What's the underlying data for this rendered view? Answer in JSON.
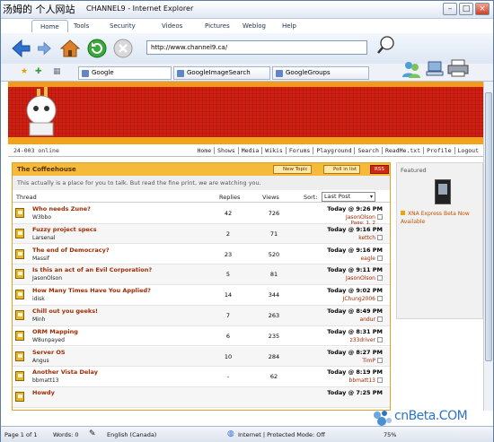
{
  "window": {
    "watermark": "汤姆的 个人网站",
    "title": "CHANNEL9 - Internet Explorer"
  },
  "menu": [
    "Home",
    "Tools",
    "Security",
    "Videos",
    "Pictures",
    "Weblog",
    "Help"
  ],
  "address": "http://www.channel9.ca/",
  "tabs": [
    "Google",
    "GoogleImageSearch",
    "GoogleGroups"
  ],
  "site": {
    "online": "24-003 online",
    "links": [
      "Home",
      "Shows",
      "Media",
      "Wikis",
      "Forums",
      "Playground",
      "Search",
      "ReadMe.txt",
      "Profile",
      "Logout"
    ]
  },
  "forum": {
    "title": "The Coffeehouse",
    "btn_new": "New Topic",
    "btn_poll": "Poll in list",
    "btn_rss": "RSS",
    "description": "This actually is a place for you to talk. But read the fine print, we are watching you.",
    "col_thread": "Thread",
    "col_replies": "Replies",
    "col_views": "Views",
    "sort_label": "Sort:",
    "sort_value": "Last Post",
    "rows": [
      {
        "title": "Who needs Zune?",
        "author": "W3bbo",
        "replies": "42",
        "views": "726",
        "time": "Today @ 9:26 PM",
        "by": "JasonOlson",
        "pages": "Page: 1, 2"
      },
      {
        "title": "Fuzzy project specs",
        "author": "Larsenal",
        "replies": "2",
        "views": "71",
        "time": "Today @ 9:16 PM",
        "by": "kettch",
        "pages": ""
      },
      {
        "title": "The end of Democracy?",
        "author": "Massif",
        "replies": "23",
        "views": "520",
        "time": "Today @ 9:16 PM",
        "by": "eagle",
        "pages": ""
      },
      {
        "title": "Is this an act of an Evil Corporation?",
        "author": "JasonOlson",
        "replies": "5",
        "views": "81",
        "time": "Today @ 9:11 PM",
        "by": "JasonOlson",
        "pages": ""
      },
      {
        "title": "How Many Times Have You Applied?",
        "author": "idisk",
        "replies": "14",
        "views": "344",
        "time": "Today @ 9:02 PM",
        "by": "JChung2006",
        "pages": ""
      },
      {
        "title": "Chill out you geeks!",
        "author": "Minh",
        "replies": "7",
        "views": "263",
        "time": "Today @ 8:49 PM",
        "by": "andur",
        "pages": ""
      },
      {
        "title": "ORM Mapping",
        "author": "W8unpayed",
        "replies": "6",
        "views": "235",
        "time": "Today @ 8:31 PM",
        "by": "z33driver",
        "pages": ""
      },
      {
        "title": "Server OS",
        "author": "Angus",
        "replies": "10",
        "views": "284",
        "time": "Today @ 8:27 PM",
        "by": "TimP",
        "pages": ""
      },
      {
        "title": "Another Vista Delay",
        "author": "bbmatt13",
        "replies": "-",
        "views": "62",
        "time": "Today @ 8:19 PM",
        "by": "bbmatt13",
        "pages": ""
      },
      {
        "title": "Howdy",
        "author": "",
        "replies": "",
        "views": "",
        "time": "Today @ 7:25 PM",
        "by": "",
        "pages": ""
      }
    ]
  },
  "featured": {
    "heading": "Featured",
    "link": "XNA Express Beta Now Available"
  },
  "status": {
    "page": "Page 1 of 1",
    "words": "Words: 0",
    "language": "English (Canada)",
    "zone": "Internet | Protected Mode: Off",
    "zoom": "75%"
  },
  "cnbeta": "cnBeta.COM",
  "colors": {
    "accent": "#d01f12",
    "forum_header": "#f6ba3a",
    "link": "#a02a00"
  }
}
